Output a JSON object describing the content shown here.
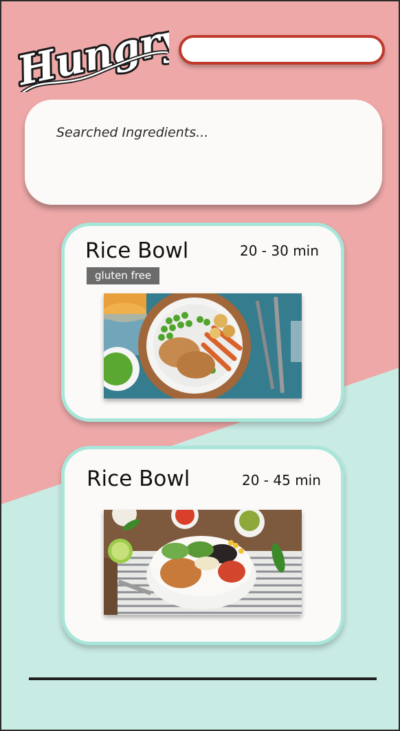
{
  "app": {
    "logo_text": "Hungry"
  },
  "search": {
    "value": "",
    "placeholder": ""
  },
  "ingredients": {
    "label": "Searched Ingredients..."
  },
  "recipes": [
    {
      "title": "Rice Bowl",
      "time": "20 - 30 min",
      "tag": "gluten free",
      "image_icon": "chicken-peas-carrots-plate"
    },
    {
      "title": "Rice Bowl",
      "time": "20 - 45 min",
      "image_icon": "burrito-bowl"
    }
  ],
  "colors": {
    "top_background": "#eea8a8",
    "bottom_background": "#c8ebe3",
    "card_border": "#a8e6da",
    "search_border": "#c0392b",
    "tag_background": "#6b6b6b"
  }
}
